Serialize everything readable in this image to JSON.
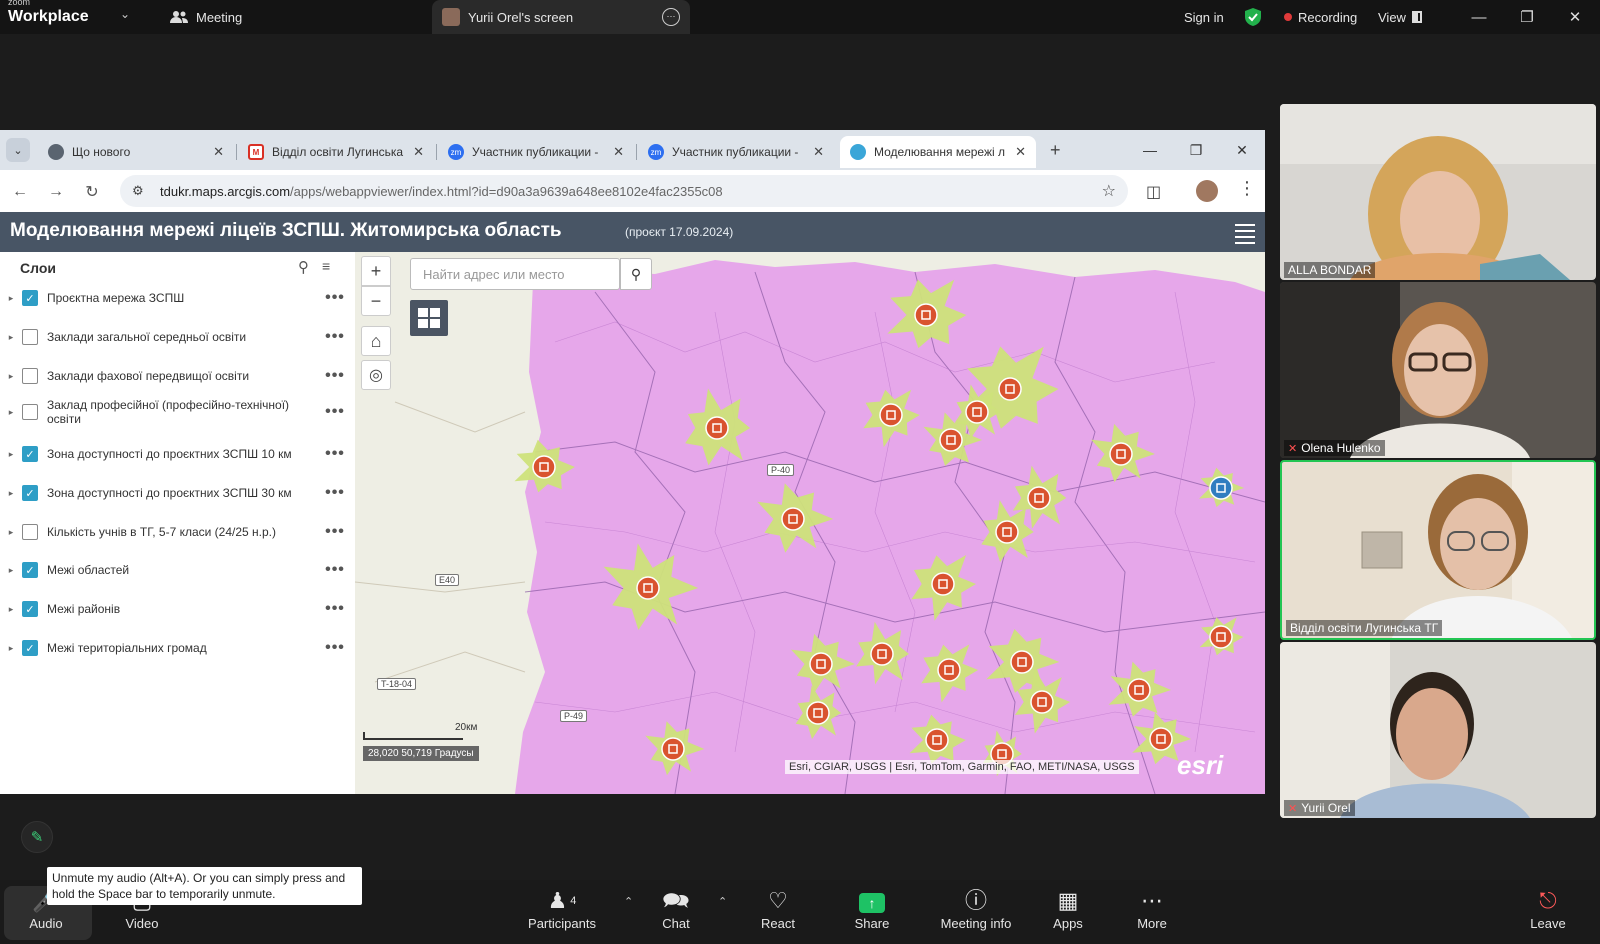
{
  "zoom": {
    "logo_small": "zoom",
    "logo_big": "Workplace",
    "meeting_tab": "Meeting",
    "screen_tab": "Yurii Orel's screen",
    "sign_in": "Sign in",
    "recording": "Recording",
    "view": "View",
    "tooltip": "Unmute my audio (Alt+A). Or you can simply press and hold the Space bar to temporarily unmute.",
    "toolbar": {
      "audio": "Audio",
      "video": "Video",
      "participants": "Participants",
      "participants_count": "4",
      "chat": "Chat",
      "react": "React",
      "share": "Share",
      "meeting_info": "Meeting info",
      "apps": "Apps",
      "more": "More",
      "leave": "Leave"
    },
    "participants": [
      {
        "name": "ALLA  BONDAR",
        "muted": false,
        "active": false
      },
      {
        "name": "Olena Hulenko",
        "muted": true,
        "active": false
      },
      {
        "name": "Відділ освіти Лугинська ТГ",
        "muted": false,
        "active": true
      },
      {
        "name": "Yurii Orel",
        "muted": true,
        "active": false
      }
    ]
  },
  "browser": {
    "tabs": [
      {
        "title": "Що нового",
        "favicon": "chrome-icon",
        "color": "#5a6470"
      },
      {
        "title": "Відділ освіти Лугинська",
        "favicon": "gmail-icon",
        "color": "#d93025"
      },
      {
        "title": "Участник публикации -",
        "favicon": "zoom-icon",
        "color": "#2d6ff0"
      },
      {
        "title": "Участник публикации -",
        "favicon": "zoom-icon",
        "color": "#2d6ff0"
      },
      {
        "title": "Моделювання мережі л",
        "favicon": "arcgis-icon",
        "color": "#3aa6d8",
        "active": true
      }
    ],
    "url_host": "tdukr.maps.arcgis.com",
    "url_path": "/apps/webappviewer/index.html?id=d90a3a9639a648ee8102e4fac2355c08"
  },
  "app": {
    "title": "Моделювання мережі ліцеїв ЗСПШ. Житомирська область",
    "subtitle": "(проєкт 17.09.2024)",
    "layers_title": "Слои",
    "layers": [
      {
        "label": "Проєктна мережа ЗСПШ",
        "checked": true
      },
      {
        "label": "Заклади загальної середньої освіти",
        "checked": false
      },
      {
        "label": "Заклади фахової передвищої освіти",
        "checked": false
      },
      {
        "label": "Заклад професійної (професійно-технічної) освіти",
        "checked": false
      },
      {
        "label": "Зона доступності до проєктних ЗСПШ 10 км",
        "checked": true
      },
      {
        "label": "Зона доступності до проєктних ЗСПШ 30 км",
        "checked": true
      },
      {
        "label": "Кількість учнів в ТГ, 5-7 класи (24/25 н.р.)",
        "checked": false
      },
      {
        "label": "Межі областей",
        "checked": true
      },
      {
        "label": "Межі районів",
        "checked": true
      },
      {
        "label": "Межі територіальних громад",
        "checked": true
      }
    ],
    "search_placeholder": "Найти адрес или место",
    "scale_label": "20км",
    "coords": "28,020 50,719 Градусы",
    "attribution": "Esri, CGIAR, USGS | Esri, TomTom, Garmin, FAO, METI/NASA, USGS",
    "esri_logo": "esri",
    "road_labels": [
      "E40",
      "T-18-04",
      "P-49",
      "P-40"
    ],
    "colors": {
      "zone30": "#e6a7ea",
      "zone10": "#cde27a",
      "marker": "#d9532f",
      "header": "#485565"
    }
  }
}
